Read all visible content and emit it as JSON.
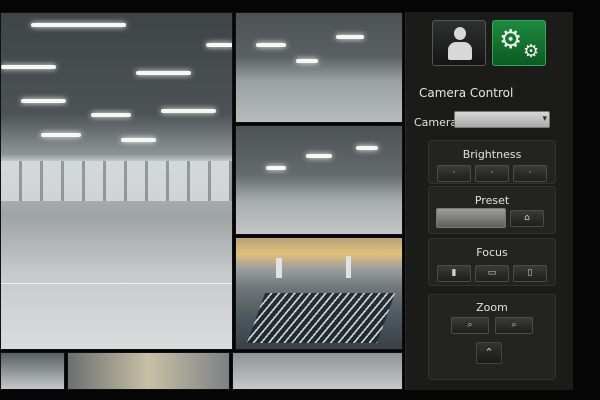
{
  "panel": {
    "title": "Camera Control",
    "camera_label": "Camera",
    "camera_value": "",
    "brightness_label": "Brightness",
    "preset_label": "Preset",
    "focus_label": "Focus",
    "zoom_label": "Zoom"
  },
  "icons": {
    "user": "user-icon",
    "settings": "gear-icon",
    "dropdown": "chevron-down-icon",
    "zoom_up": "chevron-up-icon"
  },
  "colors": {
    "settings_button": "#1d8a3e",
    "panel_bg": "#1b1c1a",
    "page_bg": "#050505"
  }
}
